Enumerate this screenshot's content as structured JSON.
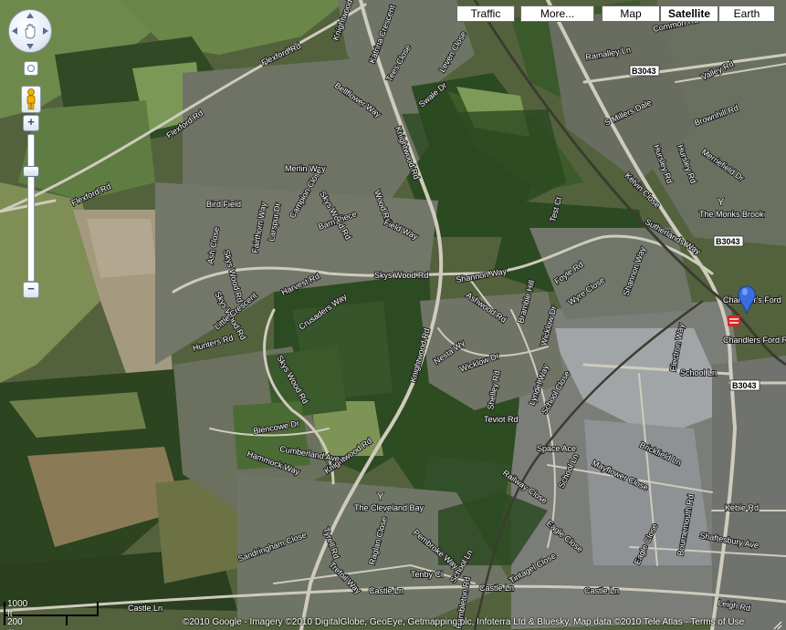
{
  "map_types": {
    "traffic": "Traffic",
    "more": "More...",
    "map": "Map",
    "satellite": "Satellite",
    "earth": "Earth",
    "selected": "Satellite"
  },
  "controls": {
    "pan_icon": "pan-hand-icon",
    "streetview_icon": "pegman-icon",
    "zoom_in": "+",
    "zoom_out": "−",
    "zoom_level_fraction": 0.25
  },
  "scale": {
    "imperial": "1000 ft",
    "metric": "200 m"
  },
  "attribution": "©2010 Google - Imagery ©2010 DigitalGlobe, GeoEye, Getmapping plc, Infoterra Ltd & Bluesky, Map data ©2010 Tele Atlas - Terms of Use",
  "roads": {
    "flexford_rd_1": "Flexford Rd",
    "flexford_rd_2": "Flexford Rd",
    "flexford_rd_3": "Flexford Rd",
    "knightwood_rd_1": "Knightwood Rd",
    "knightwood_rd_2": "Knightwood Rd",
    "knightwood_rd_3": "Knightwood Rd",
    "knightwood_rd_4": "Knightwood Rd",
    "katrina_cres": "Katrina Crescent",
    "tees_close": "Tees Close",
    "leven_close": "Leven Close",
    "swale_dr": "Swale Dr",
    "bellflower_way": "Bellflower Way",
    "merlin_way": "Merlin Way",
    "bird_field": "Bird Field",
    "larspur_dr": "Larspur Dr",
    "campion_close": "Campion Close",
    "woodsia": "Wood Rd",
    "sky_wood_rd_a": "Skys Wood Rd",
    "skys_wood_rd_b": "Skys Wood Rd",
    "skys_wood_rd_c": "Skys Wood Rd",
    "skys_wood_rd_d": "Skys Wood Rd",
    "skys_wood_rd_e": "Skys Wood Rd",
    "barn_piece": "Barn Piece",
    "field_way": "Field Way",
    "ash_close": "Ash Close",
    "fairthorn_way": "Fairthorn Way",
    "harvest_rd": "Harvest Rd",
    "crusaders_way": "Crusaders Way",
    "little_crescent": "Little Crescent",
    "hunters_rd": "Hunters Rd",
    "shannon_way_1": "Shannon Way",
    "shannon_way_2": "Shannon Way",
    "ashwood_rd": "Ashwood Rd",
    "bramble_hill": "Bramble Hill",
    "foyle_rd": "Foyle Rd",
    "wyre_close": "Wyre Close",
    "test_ct": "Test Ct",
    "wicklow_dr_1": "Wicklow Dr",
    "wicklow_dr_2": "Wicklow Dr",
    "nesta_wy": "Nesta Wy",
    "shelley_rd": "Shelley Rd",
    "teviot_rd": "Teviot Rd",
    "lyndel_way": "Lyndel Way",
    "school_close": "School Close",
    "school_ln_1": "School Ln",
    "school_ln_2": "School Ln",
    "school_ln_3": "School Ln",
    "electron_way": "Electron Way",
    "blencowe_dr": "Blencowe Dr",
    "hammock_way": "Hammock Way",
    "cumberland_ave": "Cumberland Ave",
    "ramalley_ln": "Ramalley Ln",
    "common_rd": "Common Rd",
    "valley_rd": "Valley Rd",
    "s_millers_dale": "S Millers Dale",
    "hursley_rd_1": "Hursley Rd",
    "hursley_rd_2": "Hursley Rd",
    "brownhill_rd": "Brownhill Rd",
    "merriefield_dr": "Merriefield Dr",
    "kelvin_close": "Kelvin Close",
    "sutherlands_way": "Sutherlands Way",
    "brickfield_ln": "Brickfield Ln",
    "mayflower_close": "Mayflower Close",
    "railway_close": "Railway Close",
    "eagle_close_1": "Eagle Close",
    "eagle_close_2": "Eagle Close",
    "bournemouth_rd": "Bournemouth Rd",
    "keble_rd": "Keble Rd",
    "shaftesbury_ave": "Shaftesbury Ave",
    "leigh_rd": "Leigh Rd",
    "castle_ln_1": "Castle Ln",
    "castle_ln_2": "Castle Ln",
    "castle_ln_3": "Castle Ln",
    "castle_ln_4": "Castle Ln",
    "sandringham_close": "Sandringham Close",
    "raglan_close": "Raglan Close",
    "tenby_cl": "Tenby Cl",
    "pembroke_way": "Pembroke Way",
    "tyrell_rd": "Tyrell Rd",
    "trefoil_way": "Trefoil Way",
    "tintagel_close": "Tintagel Close",
    "hambleton_rd": "Hambleton Rd",
    "b3043_1": "B3043",
    "b3043_2": "B3043",
    "b3043_3": "B3043"
  },
  "places": {
    "the_monks_brook": "The Monks Brook",
    "chandlers_ford": "Chandler's Ford",
    "chandlers_ford_rail": "Chandlers Ford Rail",
    "the_cleveland_bay": "The Cleveland Bay",
    "space_ace": "Space Ace"
  },
  "colors": {
    "pin": "#3a6de0",
    "forest": "#2f4a22",
    "field": "#6f8552",
    "housing": "#7a7a70",
    "industrial": "#9a9c9e",
    "road": "#c9c5b5"
  }
}
